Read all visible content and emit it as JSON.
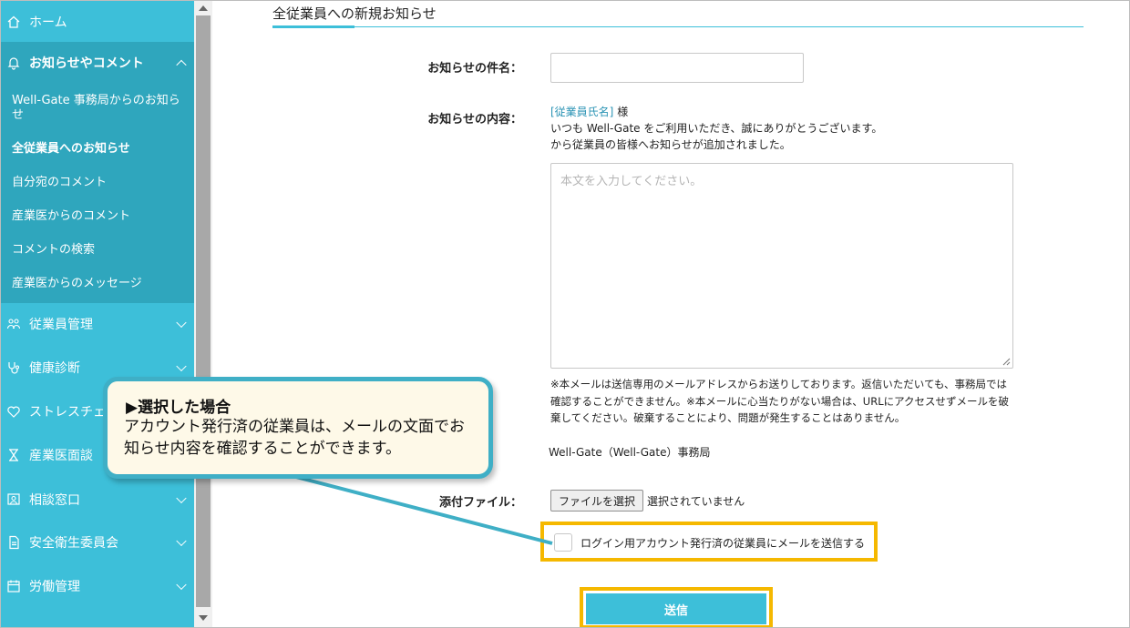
{
  "sidebar": {
    "items": [
      {
        "label": "ホーム",
        "icon": "home-icon"
      },
      {
        "label": "お知らせやコメント",
        "icon": "bell-icon"
      },
      {
        "label": "従業員管理",
        "icon": "people-icon"
      },
      {
        "label": "健康診断",
        "icon": "stethoscope-icon"
      },
      {
        "label": "ストレスチェ",
        "icon": "heart-icon"
      },
      {
        "label": "産業医面談",
        "icon": "hourglass-icon"
      },
      {
        "label": "相談窓口",
        "icon": "consult-icon"
      },
      {
        "label": "安全衛生委員会",
        "icon": "document-icon"
      },
      {
        "label": "労働管理",
        "icon": "calendar-icon"
      }
    ],
    "submenu": [
      "Well-Gate 事務局からのお知らせ",
      "全従業員へのお知らせ",
      "自分宛のコメント",
      "産業医からのコメント",
      "コメントの検索",
      "産業医からのメッセージ"
    ],
    "active_submenu": "全従業員へのお知らせ"
  },
  "main": {
    "title": "全従業員への新規お知らせ",
    "subject_label": "お知らせの件名：",
    "subject_value": "",
    "content_label": "お知らせの内容：",
    "intro_name": "[従業員氏名]",
    "intro_suffix": " 様",
    "intro_line2": "いつも Well-Gate をご利用いただき、誠にありがとうございます。",
    "intro_line3": "から従業員の皆様へお知らせが追加されました。",
    "body_placeholder": "本文を入力してください。",
    "note": "※本メールは送信専用のメールアドレスからお送りしております。返信いただいても、事務局では確認することができません。※本メールに心当たりがない場合は、URLにアクセスせずメールを破棄してください。破棄することにより、問題が発生することはありません。",
    "signature": "Well-Gate（Well-Gate）事務局",
    "attach_label": "添付ファイル：",
    "file_button": "ファイルを選択",
    "file_status": "選択されていません",
    "checkbox_label": "ログイン用アカウント発行済の従業員にメールを送信する",
    "checkbox_checked": false,
    "submit_label": "送信"
  },
  "callout": {
    "title": "▶選択した場合",
    "body": "アカウント発行済の従業員は、メールの文面でお知らせ内容を確認することができます。"
  },
  "colors": {
    "accent": "#3dbfd9",
    "sidebar_submenu": "#2fa6bd",
    "highlight": "#f5b800",
    "callout_bg": "#fef9e8"
  }
}
